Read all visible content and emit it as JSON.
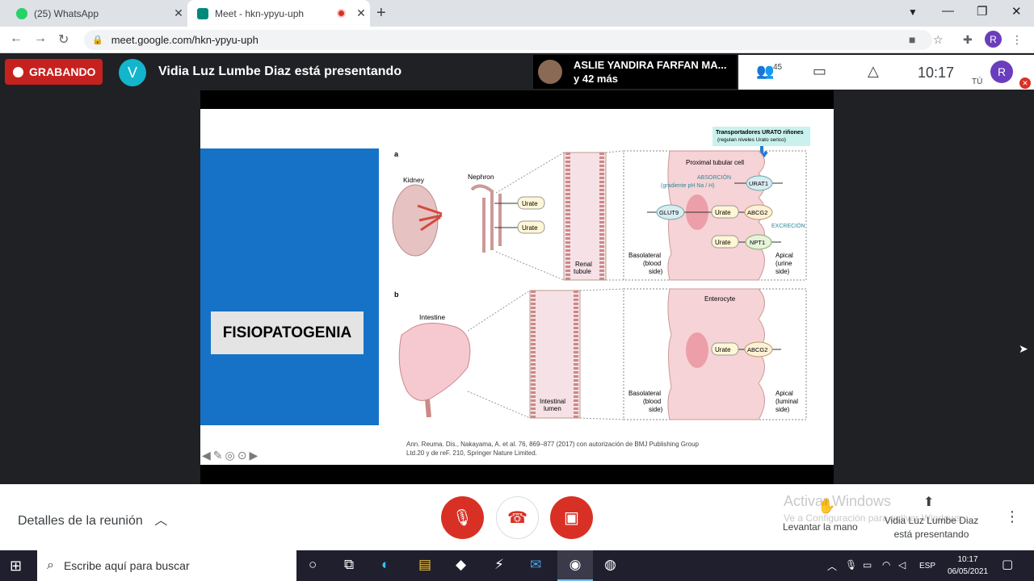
{
  "browser": {
    "tabs": [
      {
        "title": "(25) WhatsApp",
        "active": false,
        "favicon_color": "#25d366"
      },
      {
        "title": "Meet - hkn-ypyu-uph",
        "active": true,
        "favicon_color": "#00897b",
        "recording": true
      }
    ],
    "url": "meet.google.com/hkn-ypyu-uph",
    "profile_initial": "R"
  },
  "meet": {
    "recording_label": "GRABANDO",
    "presenter_initial": "V",
    "presenter_text": "Vidia Luz Lumbe Diaz está presentando",
    "participant_name": "ASLIE YANDIRA FARFAN MA...",
    "participant_more": "y 42 más",
    "participant_count": "45",
    "time": "10:17",
    "self_label": "TÚ",
    "self_initial": "R"
  },
  "slide": {
    "heading": "FISIOPATOGENIA",
    "figure": {
      "panel_a": "a",
      "panel_b": "b",
      "callout_title": "Transportadores URATO riñones",
      "callout_sub": "(regulan niveles Urato serico)",
      "kidney": "Kidney",
      "nephron": "Nephron",
      "urate": "Urate",
      "renal_tubule_1": "Renal",
      "renal_tubule_2": "tubule",
      "proximal_cell": "Proximal tubular cell",
      "absorcion": "ABSORCIÓN",
      "gradiente": "(gradiente pH Na / H)",
      "urat1": "URAT1",
      "glut9": "GLUT9",
      "abcg2": "ABCG2",
      "npt1": "NPT1",
      "excrecion": "EXCRECIÓN",
      "basolateral": "Basolateral",
      "blood": "(blood",
      "side": "side)",
      "apical": "Apical",
      "urine": "(urine",
      "intestine": "Intestine",
      "intestinal_1": "Intestinal",
      "intestinal_2": "lumen",
      "enterocyte": "Enterocyte",
      "luminal": "(luminal"
    },
    "citation_1": "Ann. Reuma. Dis., Nakayama, A. et al. 76, 869–877 (2017) con autorización de BMJ Publishing Group",
    "citation_2": "Ltd.20 y de reF. 210, Springer Nature Limited."
  },
  "controls": {
    "meeting_details": "Detalles de la reunión",
    "raise_hand": "Levantar la mano",
    "presenting_1": "Vidia Luz Lumbe Diaz",
    "presenting_2": "está presentando",
    "watermark_title": "Activar Windows",
    "watermark_sub": "Ve a Configuración para activar Windows."
  },
  "taskbar": {
    "search_placeholder": "Escribe aquí para buscar",
    "lang": "ESP",
    "time": "10:17",
    "date": "06/05/2021"
  },
  "colors": {
    "recording_red": "#c5221f",
    "slide_blue": "#1672c7",
    "meet_bg": "#202124"
  }
}
